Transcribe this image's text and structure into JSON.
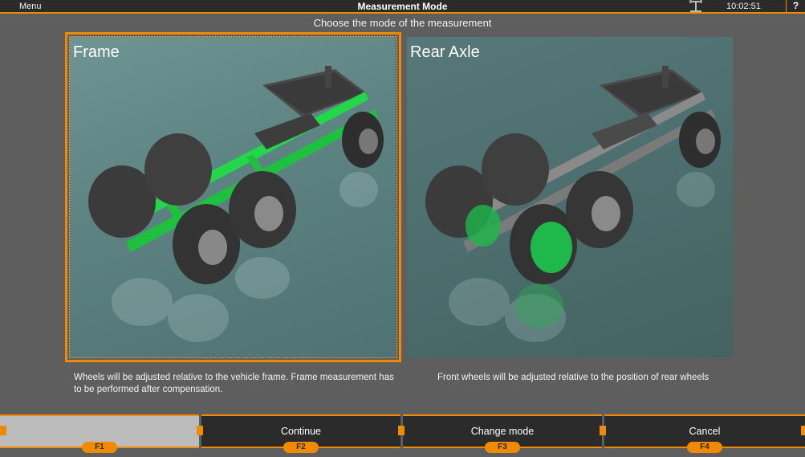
{
  "topbar": {
    "menu_label": "Menu",
    "title": "Measurement Mode",
    "clock": "10:02:51",
    "help_label": "?"
  },
  "subtitle": "Choose the mode of the measurement",
  "modes": [
    {
      "label": "Frame",
      "selected": true,
      "description": "Wheels will be adjusted relative to the vehicle frame. Frame measurement has to be performed after compensation.",
      "highlight_color": "#22d84a"
    },
    {
      "label": "Rear Axle",
      "selected": false,
      "description": "Front wheels will be adjusted relative to the position of rear wheels",
      "highlight_color": "#1fb84a"
    }
  ],
  "function_keys": [
    {
      "key": "F1",
      "label": ""
    },
    {
      "key": "F2",
      "label": "Continue"
    },
    {
      "key": "F3",
      "label": "Change mode"
    },
    {
      "key": "F4",
      "label": "Cancel"
    }
  ],
  "colors": {
    "accent": "#f08a00",
    "bar": "#2b2b2b",
    "background": "#5e5e5e"
  },
  "icons": {
    "device": "sensor-device-icon"
  }
}
